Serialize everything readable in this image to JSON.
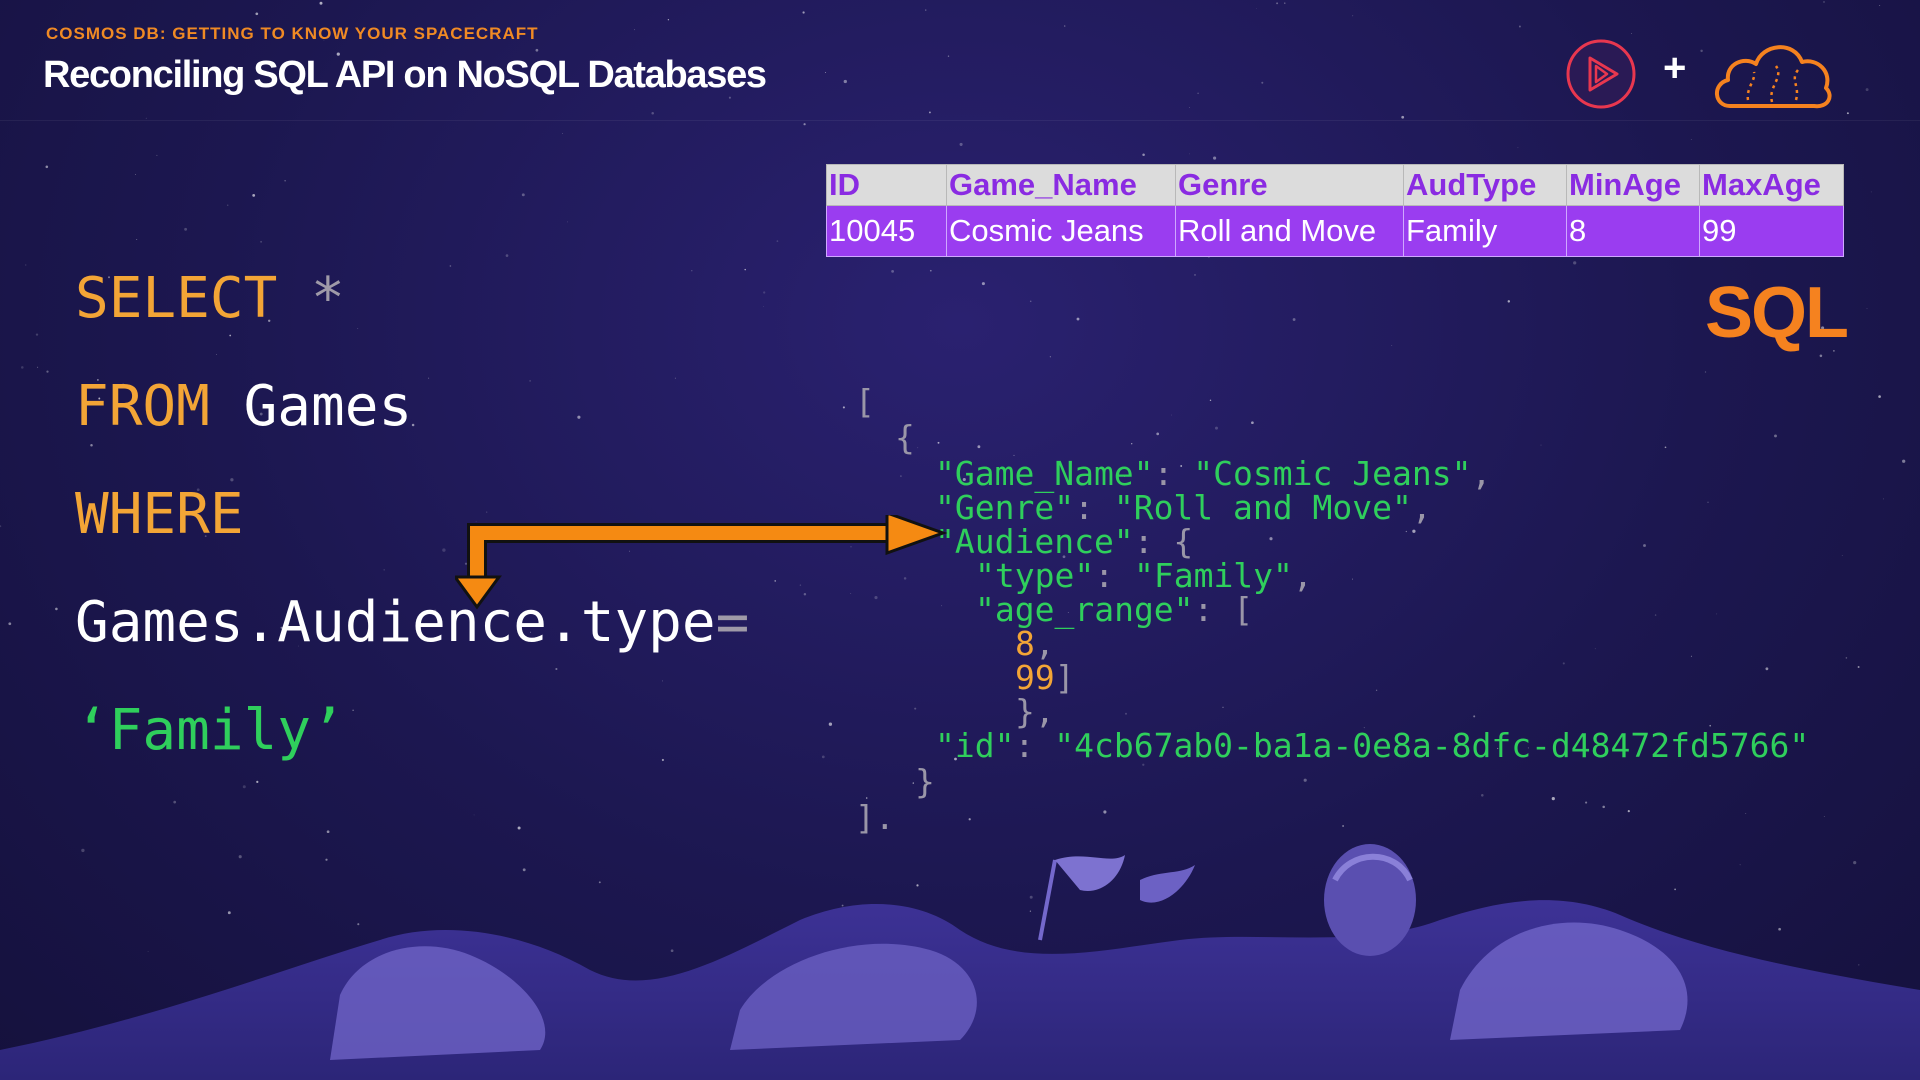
{
  "header": {
    "eyebrow": "COSMOS DB: GETTING TO KNOW YOUR SPACECRAFT",
    "title": "Reconciling SQL API on NoSQL Databases",
    "plus": "+"
  },
  "colors": {
    "accent_orange": "#f5821f",
    "keyword": "#f3a536",
    "string_green": "#2fcf5c",
    "table_header_bg": "#dcdcdc",
    "table_header_text": "#8a2be2",
    "table_row_bg": "#9a3df0",
    "background": "#1c1750"
  },
  "icons": {
    "left_logo": "play-circle-icon",
    "right_logo": "cloud-icon"
  },
  "table": {
    "headers": [
      "ID",
      "Game_Name",
      "Genre",
      "AudType",
      "MinAge",
      "MaxAge"
    ],
    "rows": [
      [
        "10045",
        "Cosmic Jeans",
        "Roll and Move",
        "Family",
        "8",
        "99"
      ]
    ]
  },
  "sql_label": "SQL",
  "query": {
    "select": "SELECT",
    "star": "*",
    "from": "FROM",
    "table": "Games",
    "where": "WHERE",
    "path": "Games.Audience.type",
    "eq": "=",
    "value": "‘Family’"
  },
  "json_doc": {
    "open_bracket": "[",
    "open_brace": "{",
    "game_name_key": "\"Game_Name\"",
    "game_name_val": "\"Cosmic Jeans\"",
    "genre_key": "\"Genre\"",
    "genre_val": "\"Roll and Move\"",
    "audience_key": "\"Audience\"",
    "type_key": "\"type\"",
    "type_val": "\"Family\"",
    "age_range_key": "\"age_range\"",
    "age_min": "8",
    "age_max": "99",
    "id_key": "\"id\"",
    "id_val": "\"4cb67ab0-ba1a-0e8a-8dfc-d48472fd5766\"",
    "close_brace": "}",
    "close_bracket": "]."
  }
}
